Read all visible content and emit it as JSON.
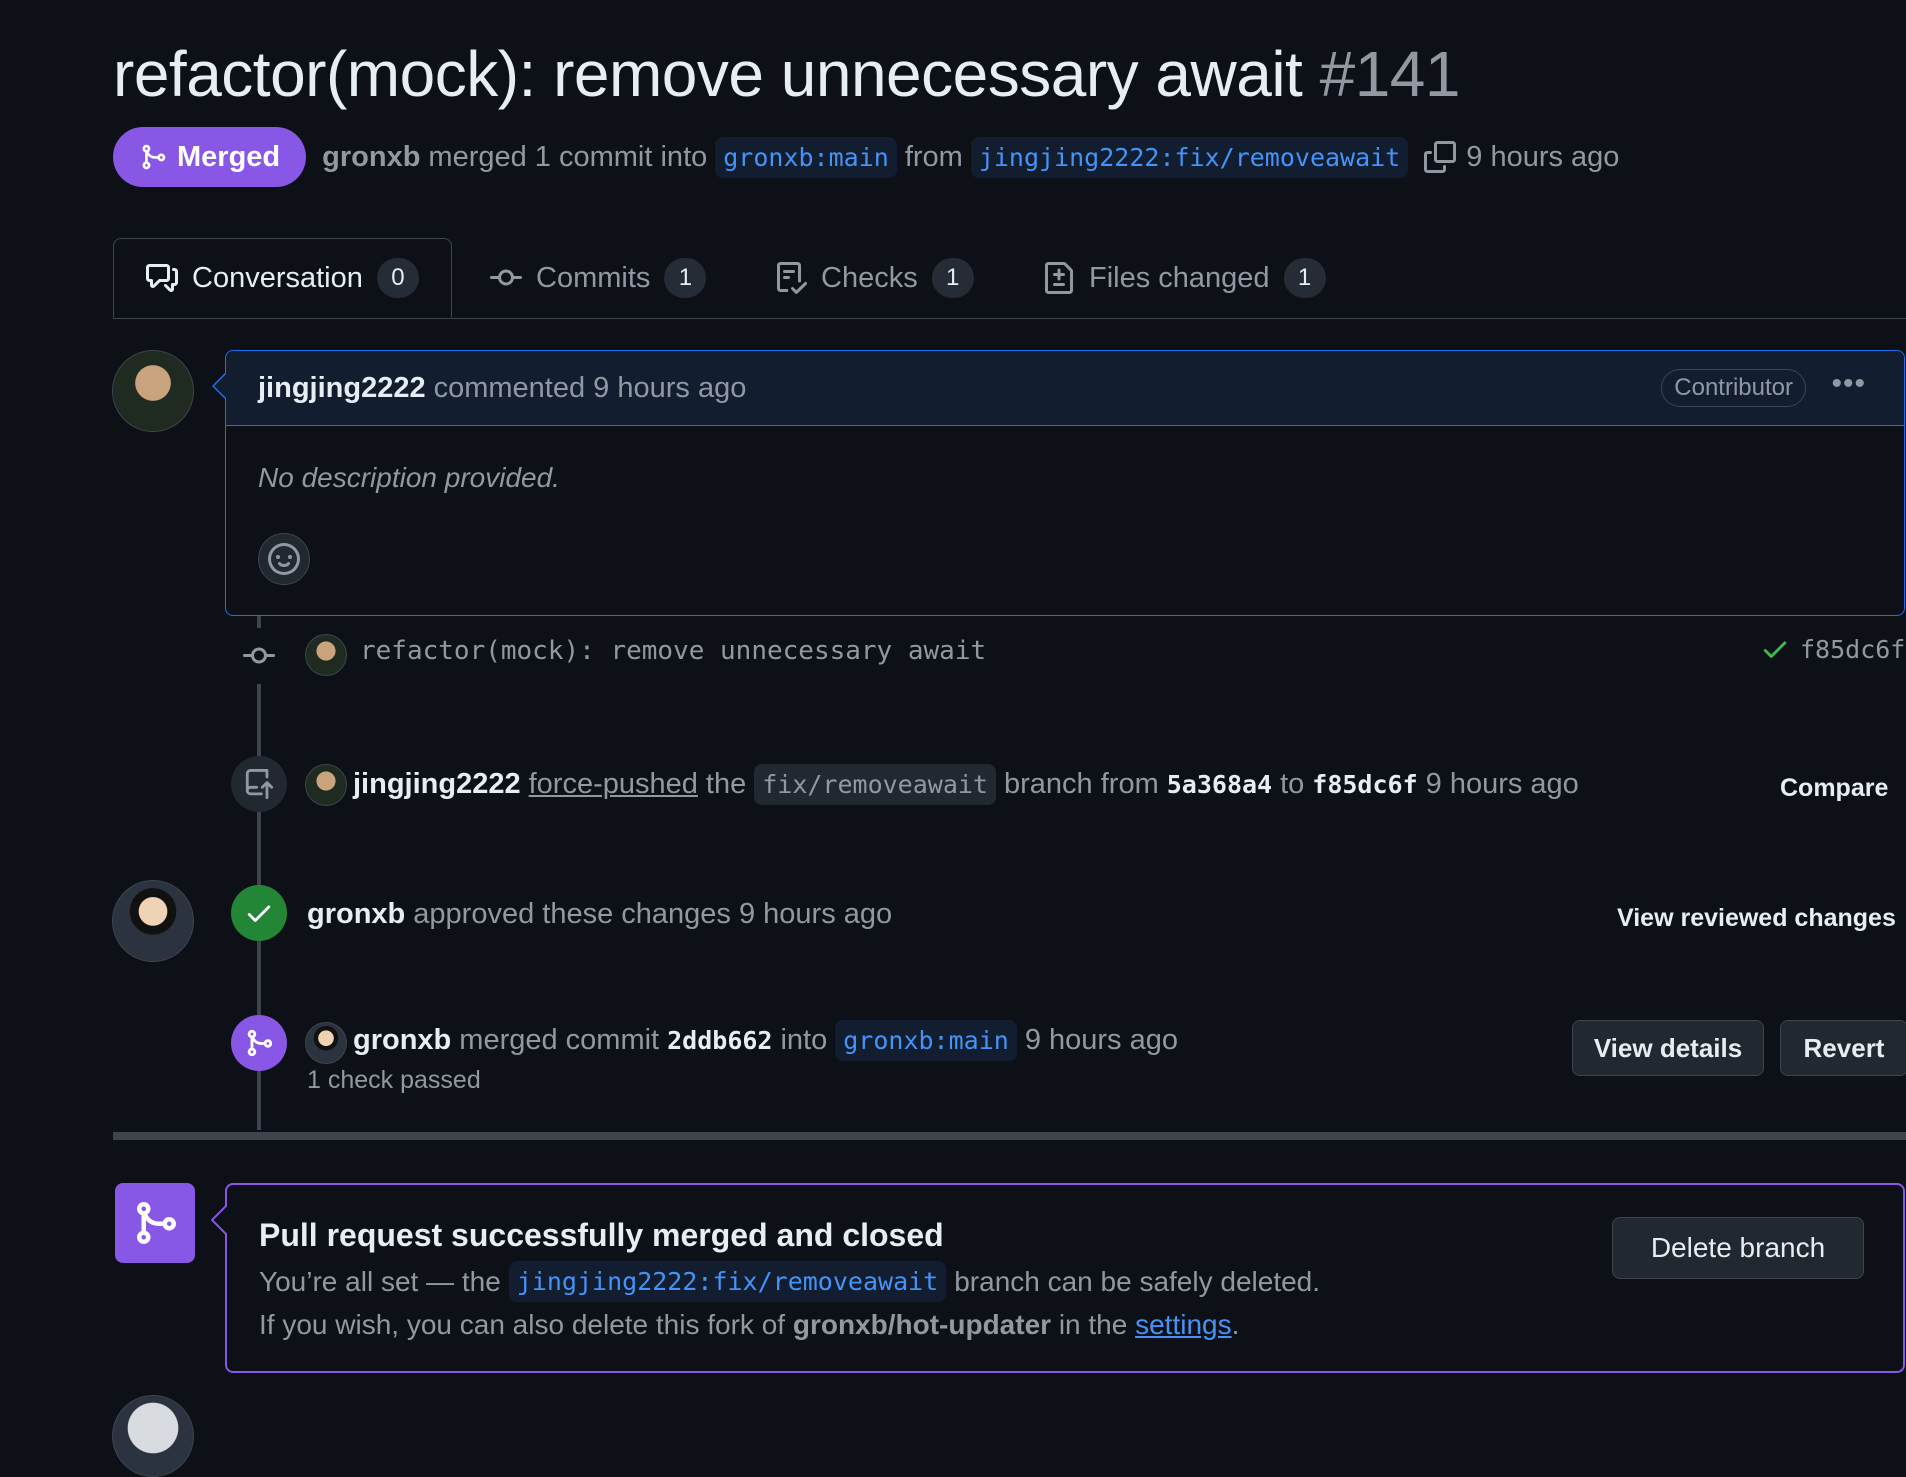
{
  "pr": {
    "title": "refactor(mock): remove unnecessary await",
    "number": "#141",
    "status": "Merged",
    "merger": "gronxb",
    "merge_text": "merged 1 commit into",
    "base_branch": "gronxb:main",
    "from_text": "from",
    "head_branch": "jingjing2222:fix/removeawait",
    "time": "9 hours ago"
  },
  "tabs": [
    {
      "label": "Conversation",
      "count": "0"
    },
    {
      "label": "Commits",
      "count": "1"
    },
    {
      "label": "Checks",
      "count": "1"
    },
    {
      "label": "Files changed",
      "count": "1"
    }
  ],
  "comment": {
    "author": "jingjing2222",
    "action": "commented 9 hours ago",
    "role": "Contributor",
    "body": "No description provided."
  },
  "timeline": {
    "commit": {
      "message": "refactor(mock): remove unnecessary await",
      "sha": "f85dc6f"
    },
    "force_push": {
      "author": "jingjing2222",
      "action": "force-pushed",
      "the": "the",
      "branch": "fix/removeawait",
      "branch_from": "branch from",
      "from_sha": "5a368a4",
      "to": "to",
      "to_sha": "f85dc6f",
      "time": "9 hours ago",
      "compare_label": "Compare"
    },
    "approval": {
      "author": "gronxb",
      "action": "approved these changes 9 hours ago",
      "view_label": "View reviewed changes"
    },
    "merge": {
      "author": "gronxb",
      "action": "merged commit",
      "sha": "2ddb662",
      "into": "into",
      "branch": "gronxb:main",
      "time": "9 hours ago",
      "checks": "1 check passed",
      "view_details_label": "View details",
      "revert_label": "Revert"
    }
  },
  "merged_box": {
    "heading": "Pull request successfully merged and closed",
    "line1_pre": "You’re all set — the",
    "branch": "jingjing2222:fix/removeawait",
    "line1_post": "branch can be safely deleted.",
    "line2_pre": "If you wish, you can also delete this fork of",
    "repo": "gronxb/hot-updater",
    "line2_mid": "in the",
    "settings_link": "settings",
    "line2_end": ".",
    "delete_label": "Delete branch"
  },
  "colors": {
    "background": "#0d1117",
    "merged_purple": "#8957e5",
    "link_blue": "#4493f8",
    "success_green": "#238636",
    "border": "#3d444d"
  }
}
